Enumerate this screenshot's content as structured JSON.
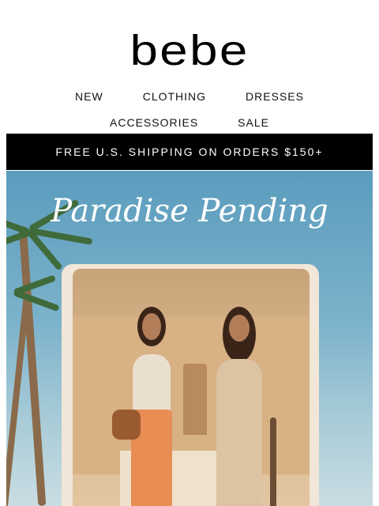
{
  "brand": {
    "logo_text": "bebe"
  },
  "nav": {
    "row1": [
      "NEW",
      "CLOTHING",
      "DRESSES"
    ],
    "row2": [
      "ACCESSORIES",
      "SALE"
    ]
  },
  "promo_bar": {
    "text": "FREE U.S. SHIPPING ON ORDERS $150+"
  },
  "hero": {
    "title": "Paradise Pending",
    "colors": {
      "sky": "#5b9cbd",
      "arch": "#f1e6d7",
      "title": "#ffffff"
    }
  }
}
